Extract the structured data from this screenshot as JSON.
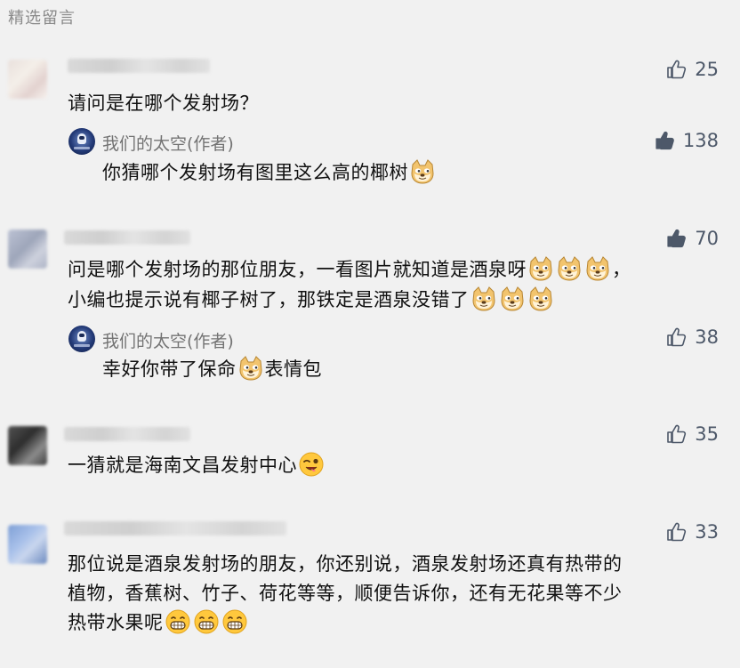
{
  "section_title": "精选留言",
  "comments": [
    {
      "text": "请问是在哪个发射场？",
      "likes": "25",
      "reply": {
        "author": "我们的太空(作者)",
        "text": "你猜哪个发射场有图里这么高的椰树",
        "likes": "138"
      }
    },
    {
      "line1": "问是哪个发射场的那位朋友，一看图片就知道是酒泉呀",
      "line1_tail": "，",
      "line2": "小编也提示说有椰子树了，那铁定是酒泉没错了",
      "likes": "70",
      "reply": {
        "author": "我们的太空(作者)",
        "text_a": "幸好你带了保命",
        "text_b": "表情包",
        "likes": "38"
      }
    },
    {
      "text": "一猜就是海南文昌发射中心",
      "likes": "35"
    },
    {
      "line1": "那位说是酒泉发射场的朋友，你还别说，酒泉发射场还真有热带的",
      "line2": "植物，香蕉树、竹子、荷花等等，顺便告诉你，还有无花果等不少",
      "line3": "热带水果呢",
      "likes": "33"
    }
  ],
  "icons": {
    "like": "thumbs-up-icon",
    "doge": "doge-emoji",
    "wink": "wink-tongue-emoji",
    "grin": "grin-emoji"
  },
  "colors": {
    "background": "#f1f1f1",
    "like_gray": "#4d5869",
    "author_gray": "#737373"
  }
}
